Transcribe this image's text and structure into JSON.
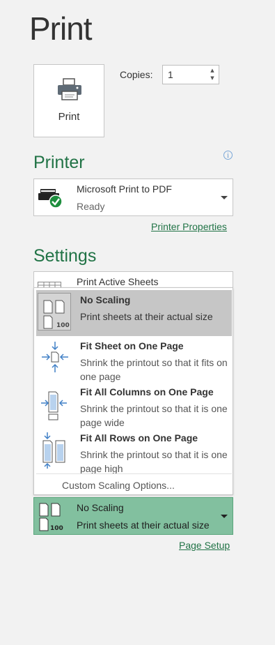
{
  "page": {
    "title": "Print"
  },
  "print_button": {
    "label": "Print",
    "icon": "printer-icon"
  },
  "copies": {
    "label": "Copies:",
    "value": "1"
  },
  "printer": {
    "heading": "Printer",
    "name": "Microsoft Print to PDF",
    "status": "Ready",
    "properties_link": "Printer Properties"
  },
  "settings": {
    "heading": "Settings",
    "sheets_option": "Print Active Sheets",
    "scaling_options": [
      {
        "title": "No Scaling",
        "description": "Print sheets at their actual size",
        "icon": "no-scaling-icon",
        "selected": true
      },
      {
        "title": "Fit Sheet on One Page",
        "description": "Shrink the printout so that it fits on one page",
        "icon": "fit-sheet-icon",
        "selected": false
      },
      {
        "title": "Fit All Columns on One Page",
        "description": "Shrink the printout so that it is one page wide",
        "icon": "fit-columns-icon",
        "selected": false
      },
      {
        "title": "Fit All Rows on One Page",
        "description": "Shrink the printout so that it is one page high",
        "icon": "fit-rows-icon",
        "selected": false
      }
    ],
    "custom_scaling": "Custom Scaling Options...",
    "current_scaling": {
      "title": "No Scaling",
      "description": "Print sheets at their actual size"
    },
    "page_setup_link": "Page Setup"
  },
  "scale_badge": "100",
  "colors": {
    "accent": "#217346",
    "selected_bg": "#82c09f",
    "menu_highlight": "#c6c6c6"
  }
}
